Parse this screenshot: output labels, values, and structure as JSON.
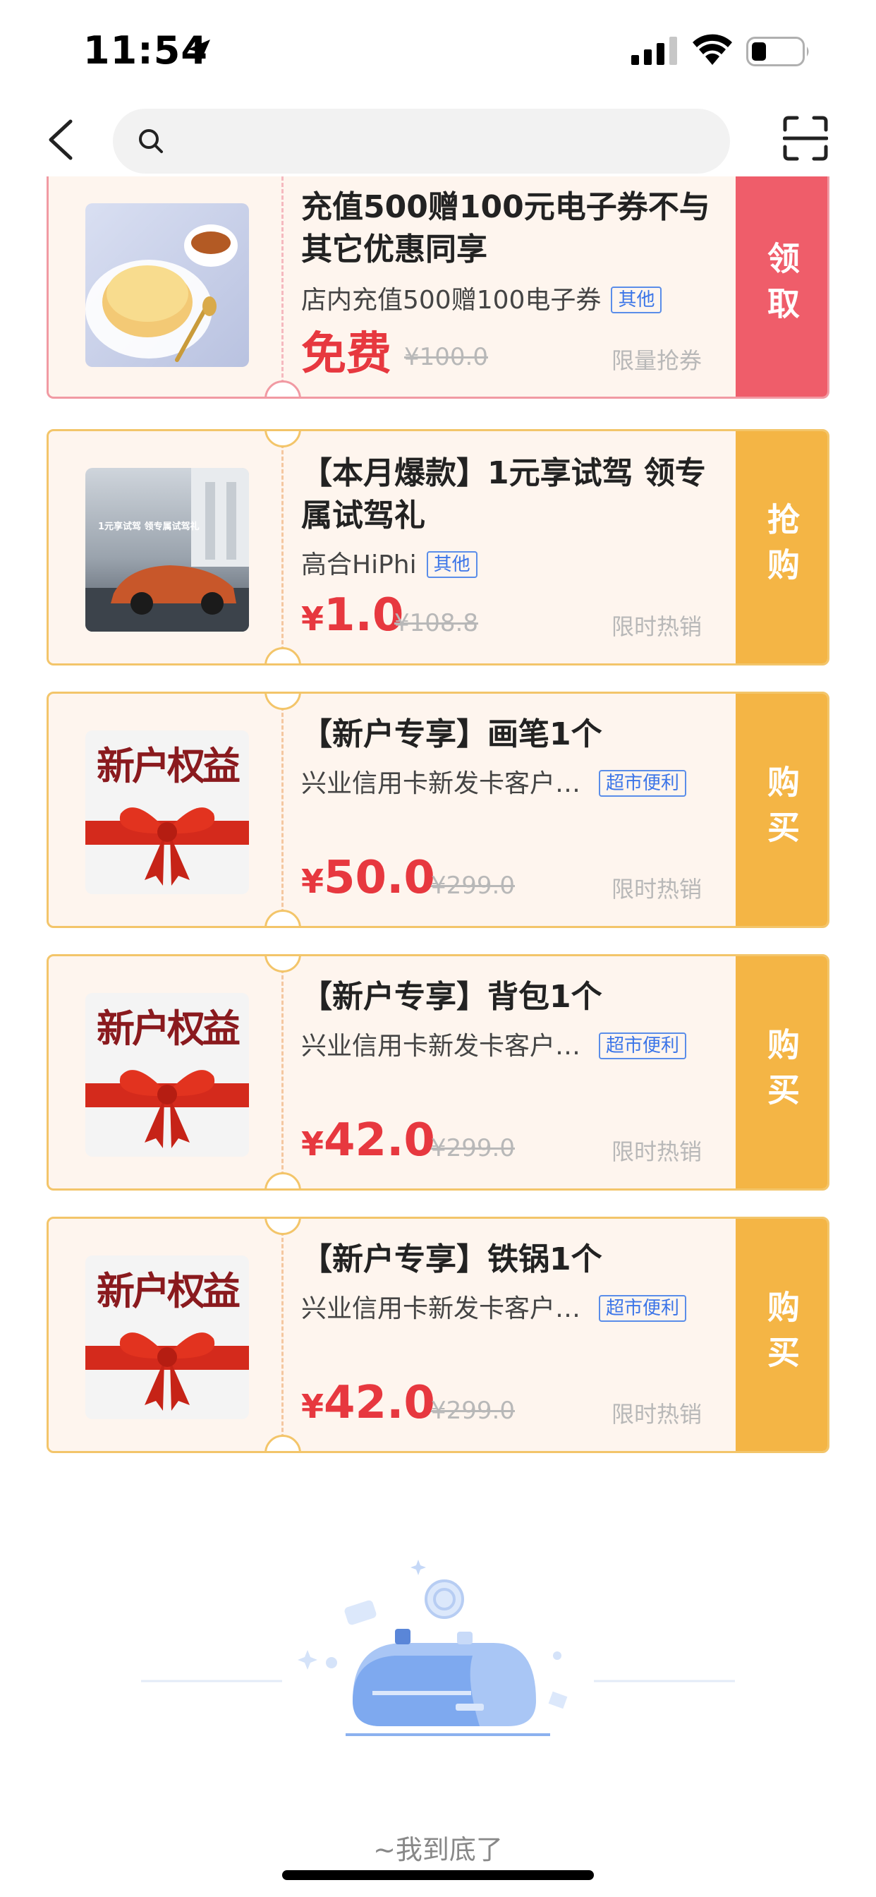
{
  "status": {
    "time": "11:54"
  },
  "coupons": [
    {
      "title": "充值500赠100元电子券不与其它优惠同享",
      "store": "店内充值500赠100电子券",
      "tag": "其他",
      "price_prefix": "",
      "price": "免费",
      "original_price": "¥100.0",
      "status_text": "限量抢券",
      "action": "领取",
      "thumb": "cake-tea-photo"
    },
    {
      "title": "【本月爆款】1元享试驾 领专属试驾礼",
      "store": "高合HiPhi",
      "tag": "其他",
      "price_prefix": "¥",
      "price": "1.0",
      "original_price": "¥108.8",
      "status_text": "限时热销",
      "action": "抢购",
      "thumb": "car-photo",
      "thumb_text": "1元享试驾 领专属试驾礼"
    },
    {
      "title": "【新户专享】画笔1个",
      "store": "兴业信用卡新发卡客户…",
      "tag": "超市便利",
      "price_prefix": "¥",
      "price": "50.0",
      "original_price": "¥299.0",
      "status_text": "限时热销",
      "action": "购买",
      "thumb": "gift-bow-image",
      "thumb_text": "新户权益"
    },
    {
      "title": "【新户专享】背包1个",
      "store": "兴业信用卡新发卡客户…",
      "tag": "超市便利",
      "price_prefix": "¥",
      "price": "42.0",
      "original_price": "¥299.0",
      "status_text": "限时热销",
      "action": "购买",
      "thumb": "gift-bow-image",
      "thumb_text": "新户权益"
    },
    {
      "title": "【新户专享】铁锅1个",
      "store": "兴业信用卡新发卡客户…",
      "tag": "超市便利",
      "price_prefix": "¥",
      "price": "42.0",
      "original_price": "¥299.0",
      "status_text": "限时热销",
      "action": "购买",
      "thumb": "gift-bow-image",
      "thumb_text": "新户权益"
    }
  ],
  "footer": {
    "end_text": "~我到底了"
  },
  "colors": {
    "price_red": "#e7383f",
    "action_gold": "#f4b545",
    "action_red": "#ef5d6a",
    "tag_blue": "#3b75e8"
  }
}
